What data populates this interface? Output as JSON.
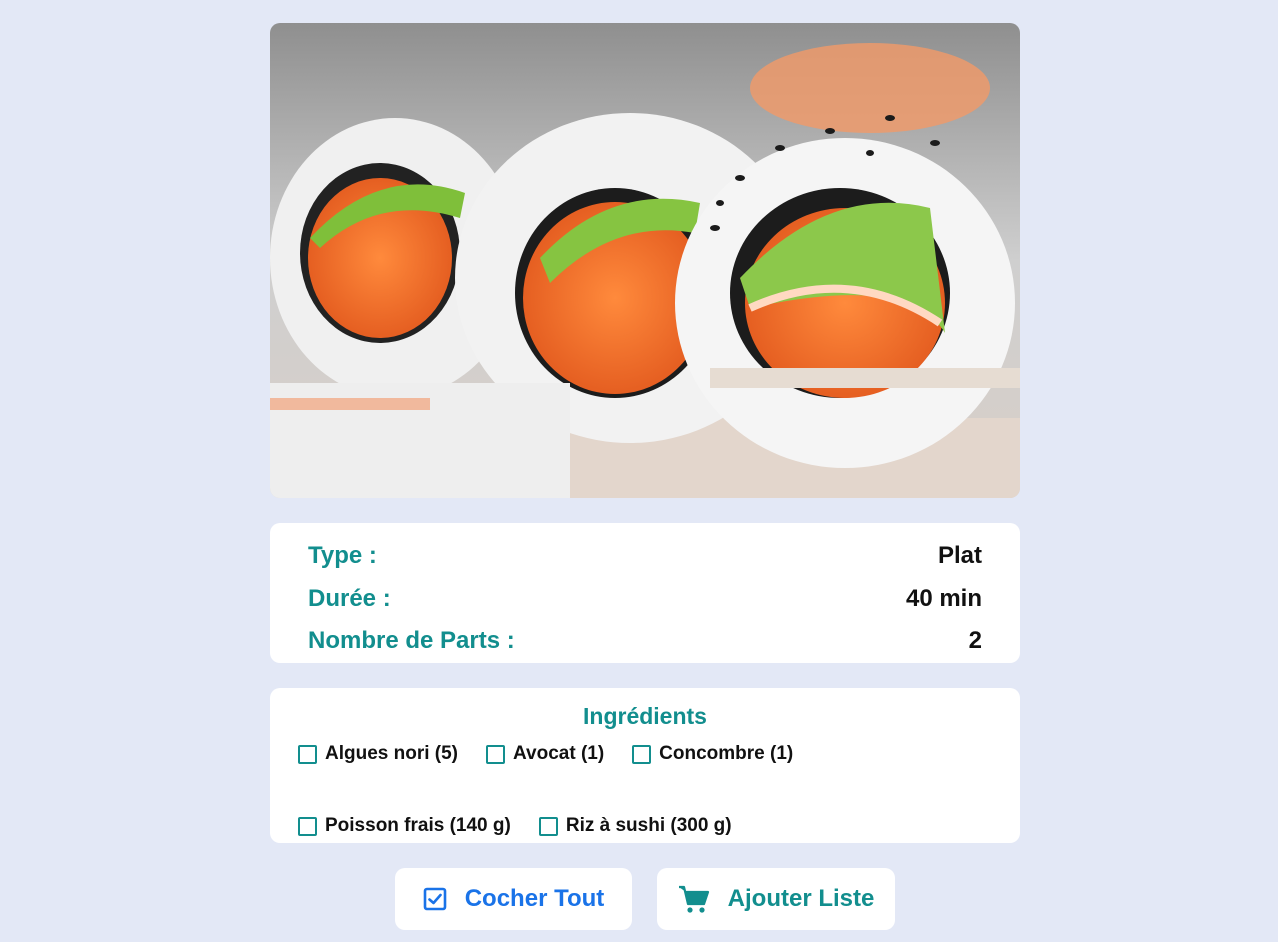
{
  "recipe": {
    "image_alt": "Sushi california maki au saumon, avocat et concombre",
    "info": [
      {
        "label": "Type :",
        "value": "Plat"
      },
      {
        "label": "Durée :",
        "value": "40 min"
      },
      {
        "label": "Nombre de Parts :",
        "value": "2"
      }
    ]
  },
  "ingredients": {
    "title": "Ingrédients",
    "items": [
      {
        "label": "Algues nori (5)",
        "checked": false
      },
      {
        "label": "Avocat (1)",
        "checked": false
      },
      {
        "label": "Concombre (1)",
        "checked": false
      },
      {
        "label": "Poisson frais (140 g)",
        "checked": false
      },
      {
        "label": "Riz à sushi (300 g)",
        "checked": false
      }
    ]
  },
  "actions": {
    "check_all": {
      "label": "Cocher Tout",
      "icon": "checkbox-checked-icon"
    },
    "add_list": {
      "label": "Ajouter Liste",
      "icon": "shopping-cart-icon"
    }
  },
  "colors": {
    "background": "#e3e8f6",
    "accent": "#128e8e",
    "link_blue": "#1a73e8",
    "card": "#ffffff"
  }
}
